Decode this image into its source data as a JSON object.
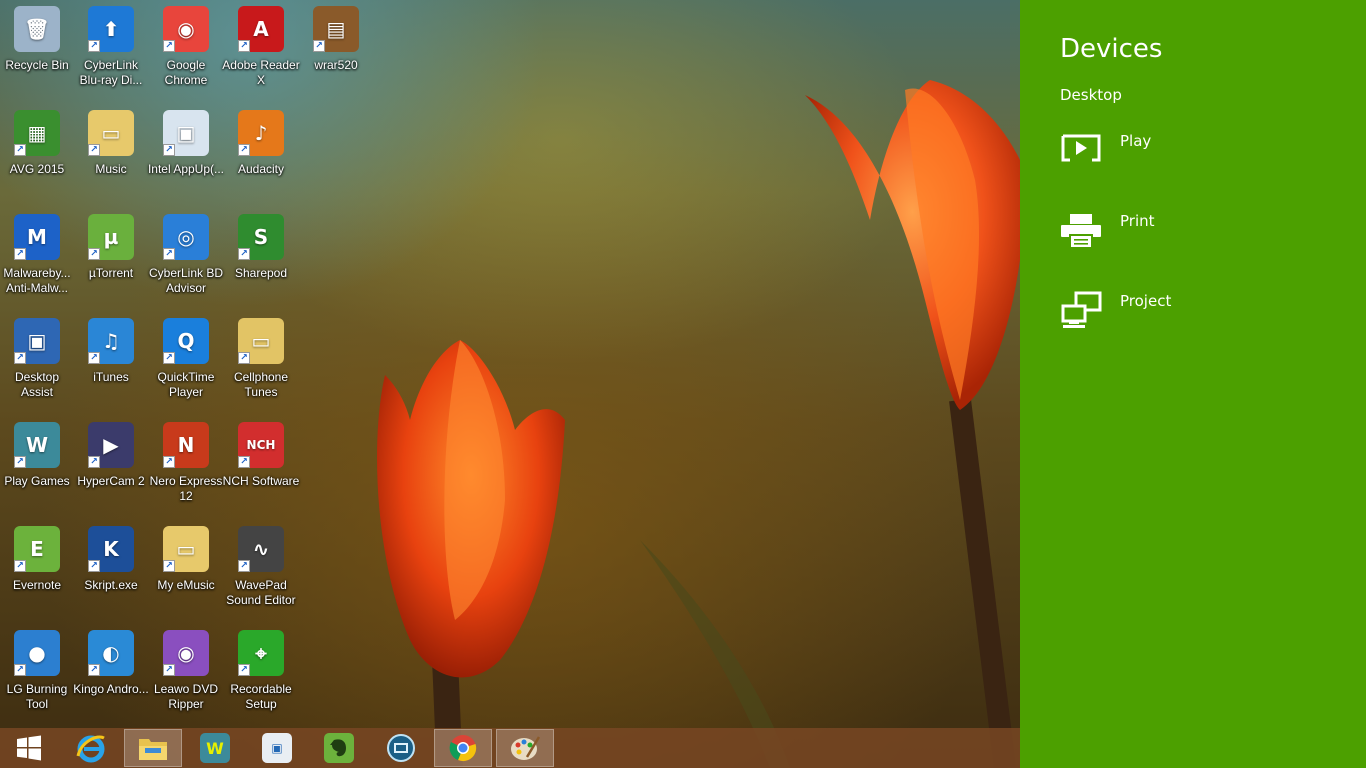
{
  "desktop": {
    "icons": [
      {
        "label": "Recycle Bin",
        "icon": "recycle-bin-icon",
        "color": "#9cb3c9"
      },
      {
        "label": "CyberLink Blu-ray Di...",
        "icon": "cyberlink-bluray-icon",
        "color": "#1e79d6"
      },
      {
        "label": "Google Chrome",
        "icon": "chrome-icon",
        "color": "#e8453c"
      },
      {
        "label": "Adobe Reader X",
        "icon": "adobe-reader-icon",
        "color": "#c8191b"
      },
      {
        "label": "wrar520",
        "icon": "winrar-icon",
        "color": "#8a5a2a"
      },
      {
        "label": "AVG 2015",
        "icon": "avg-icon",
        "color": "#3a8f2f"
      },
      {
        "label": "Music",
        "icon": "folder-icon",
        "color": "#e7c96b"
      },
      {
        "label": "Intel AppUp(...",
        "icon": "intel-appup-icon",
        "color": "#d8e4ef"
      },
      {
        "label": "Audacity",
        "icon": "audacity-icon",
        "color": "#e5781a"
      },
      {
        "label": "Malwareby... Anti-Malw...",
        "icon": "malwarebytes-icon",
        "color": "#1d62c8"
      },
      {
        "label": "µTorrent",
        "icon": "utorrent-icon",
        "color": "#6ab03d"
      },
      {
        "label": "CyberLink BD Advisor",
        "icon": "cyberlink-bd-advisor-icon",
        "color": "#2a7fd8"
      },
      {
        "label": "Sharepod",
        "icon": "sharepod-icon",
        "color": "#2f8c2f"
      },
      {
        "label": "Desktop Assist",
        "icon": "desktop-assist-icon",
        "color": "#2e67b4"
      },
      {
        "label": "iTunes",
        "icon": "itunes-icon",
        "color": "#2a86d6"
      },
      {
        "label": "QuickTime Player",
        "icon": "quicktime-icon",
        "color": "#1a7fdc"
      },
      {
        "label": "Cellphone Tunes",
        "icon": "folder-icon",
        "color": "#e2c465"
      },
      {
        "label": "Play Games",
        "icon": "wild-tangent-games-icon",
        "color": "#3c8a9a"
      },
      {
        "label": "HyperCam 2",
        "icon": "hypercam-icon",
        "color": "#3b3b6b"
      },
      {
        "label": "Nero Express 12",
        "icon": "nero-express-icon",
        "color": "#c83a1b"
      },
      {
        "label": "NCH Software",
        "icon": "nch-software-icon",
        "color": "#d22e2e"
      },
      {
        "label": "Evernote",
        "icon": "evernote-icon",
        "color": "#6cb23c"
      },
      {
        "label": "Skript.exe",
        "icon": "skript-icon",
        "color": "#1d4f99"
      },
      {
        "label": "My eMusic",
        "icon": "folder-icon",
        "color": "#e7c96b"
      },
      {
        "label": "WavePad Sound Editor",
        "icon": "wavepad-icon",
        "color": "#444444"
      },
      {
        "label": "LG Burning Tool",
        "icon": "lg-burning-tool-icon",
        "color": "#2c7fd0"
      },
      {
        "label": "Kingo Andro...",
        "icon": "kingo-android-root-icon",
        "color": "#2a8ad6"
      },
      {
        "label": "Leawo DVD Ripper",
        "icon": "leawo-dvd-ripper-icon",
        "color": "#8a4fbf"
      },
      {
        "label": "Recordable Setup",
        "icon": "recordable-setup-icon",
        "color": "#2aa82a"
      }
    ]
  },
  "taskbar": {
    "items": [
      {
        "name": "start-button",
        "icon": "windows-logo-icon",
        "active": false
      },
      {
        "name": "internet-explorer",
        "icon": "internet-explorer-icon",
        "active": false
      },
      {
        "name": "file-explorer",
        "icon": "file-explorer-icon",
        "active": true
      },
      {
        "name": "wild-tangent-games",
        "icon": "wild-tangent-games-icon",
        "active": false
      },
      {
        "name": "intel-appup",
        "icon": "intel-appup-icon",
        "active": false
      },
      {
        "name": "evernote",
        "icon": "evernote-icon",
        "active": false
      },
      {
        "name": "media-player",
        "icon": "film-reel-icon",
        "active": false
      },
      {
        "name": "google-chrome",
        "icon": "chrome-icon",
        "active": true
      },
      {
        "name": "paint",
        "icon": "paint-palette-icon",
        "active": true
      }
    ]
  },
  "charm": {
    "title": "Devices",
    "subtitle": "Desktop",
    "background": "#4ca000",
    "items": [
      {
        "label": "Play",
        "icon": "play-to-device-icon"
      },
      {
        "label": "Print",
        "icon": "printer-icon"
      },
      {
        "label": "Project",
        "icon": "project-screen-icon"
      }
    ]
  }
}
